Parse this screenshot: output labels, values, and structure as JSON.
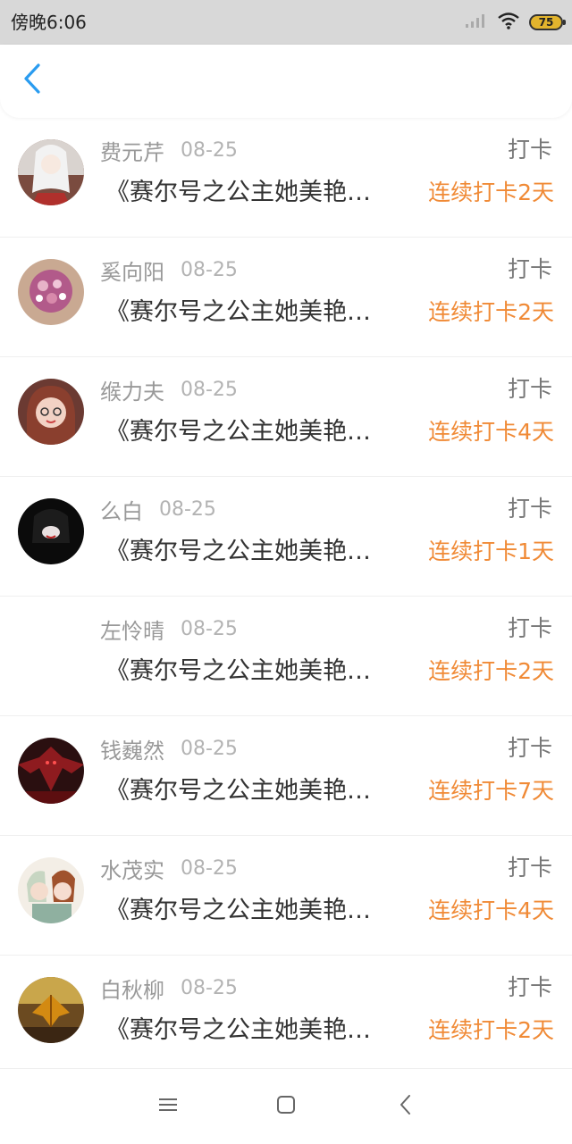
{
  "status_bar": {
    "time": "傍晚6:06",
    "battery": "75",
    "icons": [
      "signal-icon",
      "wifi-icon",
      "battery-icon"
    ]
  },
  "nav": {
    "back_icon": "chevron-left-icon"
  },
  "colors": {
    "accent_blue": "#2a9cf0",
    "streak_orange": "#f08a36"
  },
  "list": [
    {
      "name": "费元芹",
      "date": "08-25",
      "action": "打卡",
      "title": "《赛尔号之公主她美艳…",
      "streak": "连续打卡2天",
      "avatar": "avatar-white-hair-girl"
    },
    {
      "name": "奚向阳",
      "date": "08-25",
      "action": "打卡",
      "title": "《赛尔号之公主她美艳…",
      "streak": "连续打卡2天",
      "avatar": "avatar-flower-bouquet"
    },
    {
      "name": "缑力夫",
      "date": "08-25",
      "action": "打卡",
      "title": "《赛尔号之公主她美艳…",
      "streak": "连续打卡4天",
      "avatar": "avatar-girl-glasses"
    },
    {
      "name": "么白",
      "date": "08-25",
      "action": "打卡",
      "title": "《赛尔号之公主她美艳…",
      "streak": "连续打卡1天",
      "avatar": "avatar-dark-portrait"
    },
    {
      "name": "左怜晴",
      "date": "08-25",
      "action": "打卡",
      "title": "《赛尔号之公主她美艳…",
      "streak": "连续打卡2天",
      "avatar": "avatar-blank"
    },
    {
      "name": "钱巍然",
      "date": "08-25",
      "action": "打卡",
      "title": "《赛尔号之公主她美艳…",
      "streak": "连续打卡7天",
      "avatar": "avatar-red-demon"
    },
    {
      "name": "水茂实",
      "date": "08-25",
      "action": "打卡",
      "title": "《赛尔号之公主她美艳…",
      "streak": "连续打卡4天",
      "avatar": "avatar-anime-couple"
    },
    {
      "name": "白秋柳",
      "date": "08-25",
      "action": "打卡",
      "title": "《赛尔号之公主她美艳…",
      "streak": "连续打卡2天",
      "avatar": "avatar-autumn-leaf"
    }
  ],
  "bottom_nav": {
    "buttons": [
      "menu-icon",
      "home-square-icon",
      "back-triangle-icon"
    ]
  }
}
